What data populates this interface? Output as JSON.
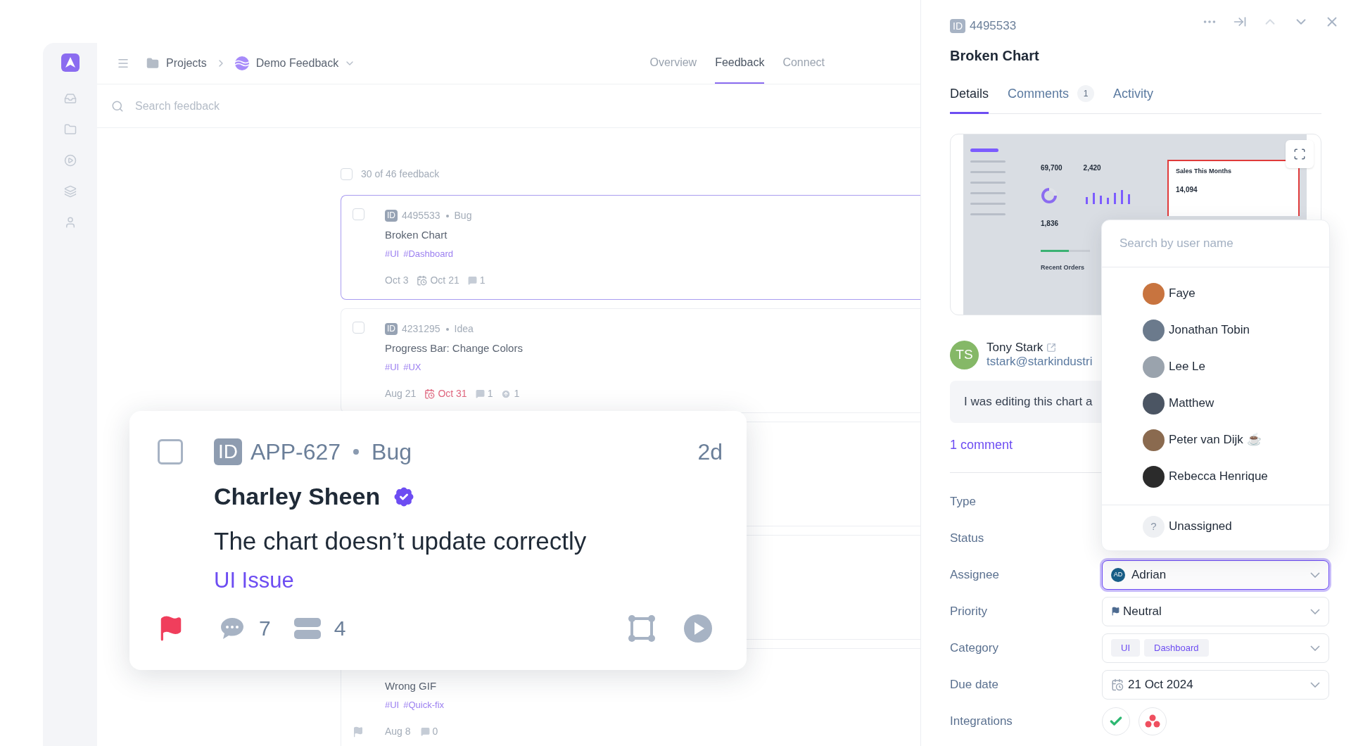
{
  "breadcrumbs": [
    "Projects",
    "Demo Feedback"
  ],
  "tabs": [
    {
      "label": "Overview",
      "selected": false
    },
    {
      "label": "Feedback",
      "selected": true
    },
    {
      "label": "Connect",
      "selected": false
    }
  ],
  "search": {
    "placeholder": "Search feedback"
  },
  "list": {
    "checked": false,
    "count": "30 of 46 feedback",
    "items": [
      {
        "kind": "full",
        "id_badge": "ID",
        "id": "4495533",
        "type": "Bug",
        "title": "Broken Chart",
        "tags": [
          "#UI",
          "#Dashboard"
        ],
        "created": "Oct 3",
        "due": "Oct 21",
        "overdue": false,
        "comments": "1",
        "selected": true
      },
      {
        "kind": "full",
        "id_badge": "ID",
        "id": "4231295",
        "type": "Idea",
        "title": "Progress Bar: Change Colors",
        "tags": [
          "#UI",
          "#UX"
        ],
        "created": "Aug 21",
        "due": "Oct 31",
        "overdue": true,
        "comments": "1",
        "upvotes": "1",
        "selected": false
      },
      {
        "kind": "covered",
        "selected": false
      },
      {
        "kind": "covered",
        "selected": false
      },
      {
        "kind": "partial",
        "title": "Wrong GIF",
        "tags": [
          "#UI",
          "#Quick-fix"
        ],
        "created": "Aug 8",
        "comments": "0",
        "flag": true,
        "selected": false
      }
    ]
  },
  "drag_card": {
    "checked": false,
    "id_badge": "ID",
    "id": "APP-627",
    "type": "Bug",
    "age": "2d",
    "author": "Charley Sheen",
    "verified": true,
    "title": "The chart doesn’t update correctly",
    "category": "UI Issue",
    "flag": true,
    "comments": "7",
    "stack": "4"
  },
  "detail": {
    "id_badge": "ID",
    "id": "4495533",
    "title": "Broken Chart",
    "tabs": [
      {
        "label": "Details",
        "selected": true
      },
      {
        "label": "Comments",
        "badge": "1",
        "selected": false
      },
      {
        "label": "Activity",
        "selected": false
      }
    ],
    "screenshot": {
      "stats": [
        "69,700",
        "2,420"
      ],
      "third_stat": "1,836",
      "card_title": "Sales This Months",
      "card_value": "14,094",
      "section": "Recent Orders"
    },
    "author": {
      "initials": "TS",
      "name": "Tony Stark",
      "email": "tstark@starkindustri"
    },
    "comment": "I was editing this chart a",
    "comments_link": "1 comment",
    "fields": [
      {
        "label": "Type",
        "kind": "covered"
      },
      {
        "label": "Status",
        "kind": "covered"
      },
      {
        "label": "Assignee",
        "kind": "user",
        "initials": "AD",
        "value": "Adrian",
        "focused": true
      },
      {
        "label": "Priority",
        "kind": "priority",
        "value": "Neutral",
        "focused": false
      },
      {
        "label": "Category",
        "kind": "chips",
        "chips": [
          "UI",
          "Dashboard"
        ],
        "focused": false
      },
      {
        "label": "Due date",
        "kind": "date",
        "value": "21 Oct 2024",
        "focused": false
      },
      {
        "label": "Integrations",
        "kind": "integrations"
      }
    ]
  },
  "user_menu": {
    "placeholder": "Search by user name",
    "users": [
      {
        "name": "Faye",
        "color": "#c8743f"
      },
      {
        "name": "Jonathan Tobin",
        "color": "#6b7a8c"
      },
      {
        "name": "Lee Le",
        "color": "#9aa3ad"
      },
      {
        "name": "Matthew",
        "color": "#4b5563"
      },
      {
        "name": "Peter van Dijk ☕",
        "color": "#8a6a4f"
      },
      {
        "name": "Rebecca Henrique",
        "color": "#2b2b2b"
      }
    ],
    "unassigned_icon": "?",
    "unassigned": "Unassigned"
  }
}
